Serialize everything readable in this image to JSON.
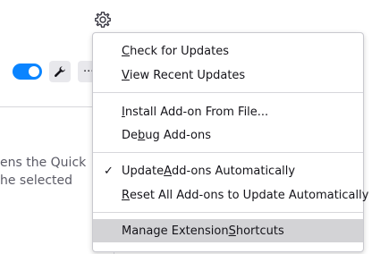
{
  "background": {
    "toggle_color": "#0a84ff",
    "more_label": "···",
    "description_lines": [
      "ens the Quick",
      "he selected"
    ]
  },
  "menu": {
    "items": [
      {
        "before": "",
        "key": "C",
        "after": "heck for Updates"
      },
      {
        "before": "",
        "key": "V",
        "after": "iew Recent Updates"
      },
      {
        "before": "",
        "key": "I",
        "after": "nstall Add-on From File..."
      },
      {
        "before": "De",
        "key": "b",
        "after": "ug Add-ons"
      },
      {
        "before": "Update ",
        "key": "A",
        "after": "dd-ons Automatically",
        "checked": true
      },
      {
        "before": "",
        "key": "R",
        "after": "eset All Add-ons to Update Automatically"
      },
      {
        "before": "Manage Extension ",
        "key": "S",
        "after": "hortcuts",
        "selected": true
      }
    ],
    "check_glyph": "✓"
  }
}
